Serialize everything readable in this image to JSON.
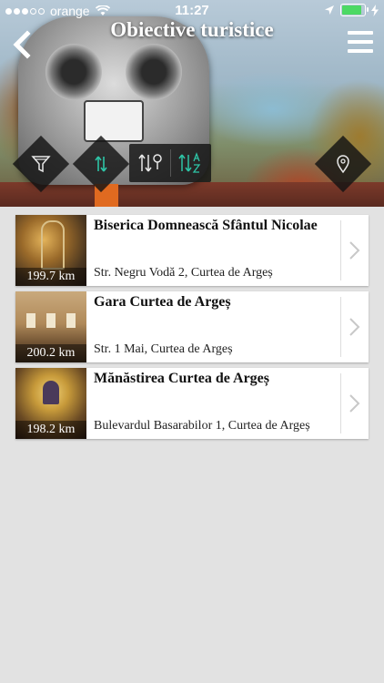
{
  "status_bar": {
    "carrier": "orange",
    "time": "11:27",
    "signal_bars_filled": 3,
    "signal_bars_total": 5
  },
  "header": {
    "title": "Obiective turistice",
    "back_icon": "chevron-left-icon",
    "menu_icon": "hamburger-menu-icon"
  },
  "toolbar": {
    "filter_icon": "funnel-icon",
    "sort_icon": "sort-arrows-icon",
    "sort_distance_icon": "sort-distance-icon",
    "sort_alpha_icon": "sort-alpha-icon",
    "map_icon": "map-pin-icon",
    "accent_color": "#2ec4a6"
  },
  "places": [
    {
      "name": "Biserica Domnească Sfântul Nicolae",
      "address": "Str. Negru Vodă 2, Curtea de Argeș",
      "distance": "199.7 km"
    },
    {
      "name": "Gara Curtea de Argeș",
      "address": "Str. 1 Mai, Curtea de Argeș",
      "distance": "200.2 km"
    },
    {
      "name": "Mănăstirea Curtea de Argeș",
      "address": "Bulevardul Basarabilor 1, Curtea de Argeș",
      "distance": "198.2 km"
    }
  ]
}
